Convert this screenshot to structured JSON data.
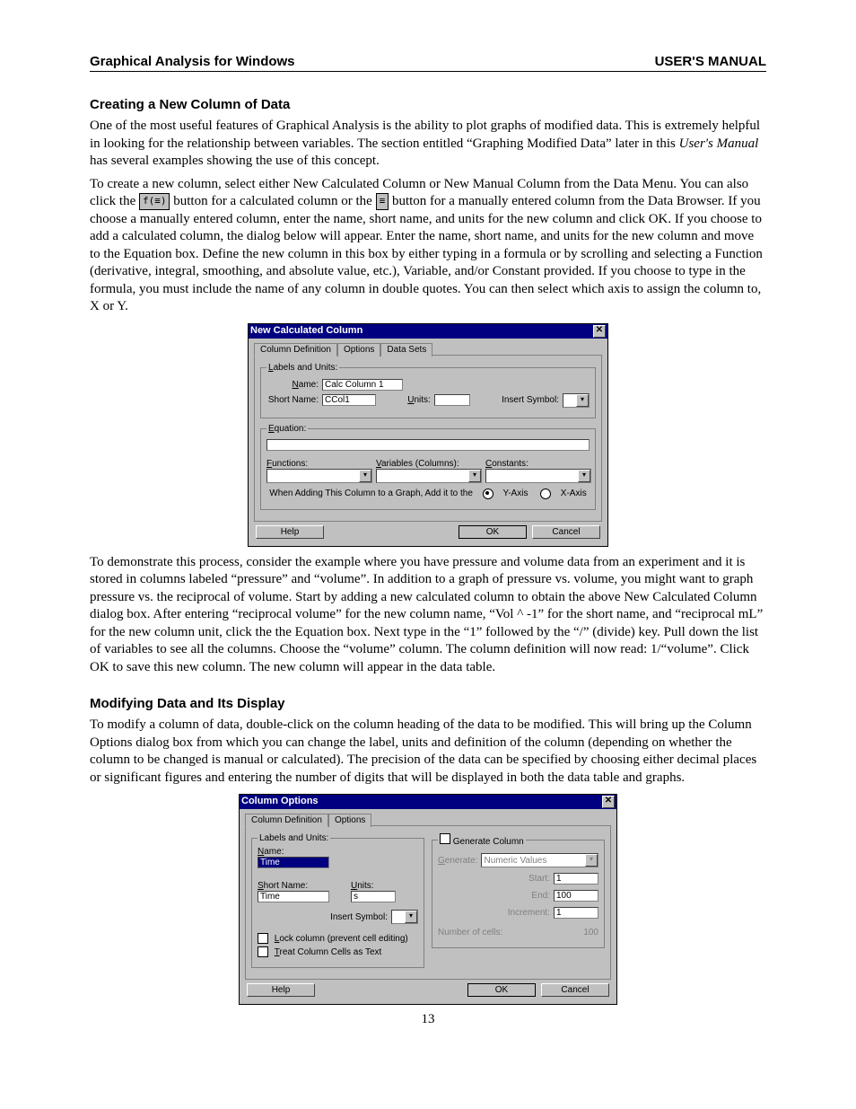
{
  "header": {
    "left": "Graphical Analysis for Windows",
    "right": "USER'S MANUAL"
  },
  "page_number": "13",
  "sections": {
    "s1_title": "Creating a New Column of Data",
    "s1_p1a": "One of the most useful features of Graphical Analysis is the ability to plot graphs of modified data. This is extremely helpful in looking for the relationship between variables. The section entitled “Graphing Modified Data” later in this ",
    "s1_p1b": "User's Manual",
    "s1_p1c": " has several examples showing the use of this concept.",
    "s1_p2a": "To create a new column, select either New Calculated Column or New Manual Column from the Data Menu. You can also click the ",
    "s1_p2b": " button for a calculated column or the ",
    "s1_p2c": " button for a manually entered column from the Data Browser. If you choose a manually entered column, enter the name, short name, and units for the new column and click OK. If you choose to add a calculated column, the dialog below will appear. Enter the name, short name, and units for the new column and move to the Equation box. Define the new column in this box by either typing in a formula or by scrolling and selecting a Function (derivative, integral, smoothing, and absolute value, etc.), Variable, and/or Constant provided. If you choose to type in the formula, you must include the name of any column in double quotes. You can then select which axis to assign the column to, X or Y.",
    "s1_p3": "To demonstrate this process, consider the example where you have pressure and volume data from an experiment and it is stored in columns labeled “pressure” and “volume”. In addition to a graph of pressure vs. volume, you might want to graph pressure vs. the reciprocal of volume. Start by adding a new calculated column to obtain the above New Calculated Column dialog box. After entering “reciprocal volume” for the new column name, “Vol ^ -1” for the short name, and “reciprocal mL” for the new column unit, click the the Equation box. Next type in the “1” followed by the “/” (divide) key. Pull down the list of variables to see all the columns. Choose the “volume” column. The column definition will now read: 1/“volume”. Click OK to save this new column. The new column will appear in the data table.",
    "s2_title": "Modifying Data and Its Display",
    "s2_p1": "To modify a column of data, double-click on the column heading of the data to be modified. This will bring up the Column Options dialog box from which you can change the label, units and definition of the column (depending on whether the column to be changed is manual or calculated). The precision of the data can be specified by choosing either decimal places or significant figures and entering the number of digits that will be displayed in both the data table and graphs."
  },
  "dialog1": {
    "title": "New Calculated Column",
    "tabs": [
      "Column Definition",
      "Options",
      "Data Sets"
    ],
    "group_labels": "Labels and Units:",
    "name_label": "Name:",
    "name_value": "Calc Column 1",
    "short_label": "Short Name:",
    "short_value": "CCol1",
    "units_label": "Units:",
    "insert_label": "Insert Symbol:",
    "group_eq": "Equation:",
    "functions_label": "Functions:",
    "variables_label": "Variables (Columns):",
    "constants_label": "Constants:",
    "addline": "When Adding This Column to a Graph, Add it to the",
    "yaxis": "Y-Axis",
    "xaxis": "X-Axis",
    "help": "Help",
    "ok": "OK",
    "cancel": "Cancel"
  },
  "dialog2": {
    "title": "Column Options",
    "tabs": [
      "Column Definition",
      "Options"
    ],
    "group_labels": "Labels and Units:",
    "name_label": "Name:",
    "name_value": "Time",
    "short_label": "Short Name:",
    "short_value": "Time",
    "units_label": "Units:",
    "units_value": "s",
    "insert_label": "Insert Symbol:",
    "lock_label": "Lock column (prevent cell editing)",
    "treat_label": "Treat Column Cells as Text",
    "group_gen": "Generate Column",
    "gen_label": "Generate:",
    "gen_value": "Numeric Values",
    "start_label": "Start:",
    "start_value": "1",
    "end_label": "End:",
    "end_value": "100",
    "inc_label": "Increment:",
    "inc_value": "1",
    "num_label": "Number of cells:",
    "num_value": "100",
    "help": "Help",
    "ok": "OK",
    "cancel": "Cancel"
  }
}
